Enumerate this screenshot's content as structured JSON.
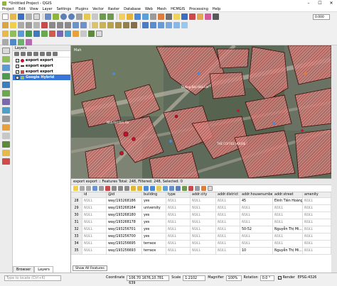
{
  "window": {
    "title": "*Untitled Project - QGIS"
  },
  "menu": [
    "Project",
    "Edit",
    "View",
    "Layer",
    "Settings",
    "Plugins",
    "Vector",
    "Raster",
    "Database",
    "Web",
    "Mesh",
    "HCMGIS",
    "Processing",
    "Help"
  ],
  "toolbar": {
    "zoom_value": "0.000"
  },
  "layers_panel": {
    "title": "Layers",
    "layers": [
      {
        "name": "export export",
        "color": "#c8102e",
        "checked": true
      },
      {
        "name": "export export",
        "color": "#333333",
        "checked": true
      },
      {
        "name": "export export",
        "color": "#d14a4a",
        "checked": true
      },
      {
        "name": "Google Hybrid",
        "checked": true,
        "selected": true
      }
    ],
    "tabs": [
      "Browser",
      "Layers"
    ]
  },
  "map_labels": [
    "Mah",
    "Đường Bác Hòa Lợi",
    "Nhà thờ Đức Bà",
    "THE COFFEE HOUSE"
  ],
  "attribute_table": {
    "title": "export export :: Features Total: 248, Filtered: 248, Selected: 0",
    "columns": [
      "id",
      "@id",
      "building",
      "type",
      "addr:city",
      "addr:district",
      "addr:housenumber",
      "addr:street",
      "amenity"
    ],
    "rows": [
      {
        "n": "28",
        "id": "way/193268186",
        "building": "yes",
        "housenumber": "45",
        "street": "Đinh Tiên Hoàng"
      },
      {
        "n": "29",
        "id": "way/193268184",
        "building": "university",
        "housenumber": "NULL",
        "street": "NULL"
      },
      {
        "n": "30",
        "id": "way/193268180",
        "building": "yes",
        "housenumber": "NULL",
        "street": "NULL"
      },
      {
        "n": "31",
        "id": "way/193268178",
        "building": "yes",
        "housenumber": "NULL",
        "street": "NULL"
      },
      {
        "n": "32",
        "id": "way/193256701",
        "building": "yes",
        "housenumber": "50-52",
        "street": "Nguyễn Thị Mi..."
      },
      {
        "n": "33",
        "id": "way/193256700",
        "building": "yes",
        "housenumber": "NULL",
        "street": "NULL"
      },
      {
        "n": "34",
        "id": "way/193256695",
        "building": "terrace",
        "housenumber": "NULL",
        "street": "NULL"
      },
      {
        "n": "35",
        "id": "way/193256693",
        "building": "terrace",
        "housenumber": "10",
        "street": "Nguyễn Thị Mi..."
      }
    ],
    "null_text": "NULL",
    "show_all": "Show All Features"
  },
  "statusbar": {
    "search_placeholder": "Type to locate (Ctrl+K)",
    "coordinate_label": "Coordinate",
    "coordinate": "106.70 1676,10.781 639",
    "scale_label": "Scale",
    "scale": "1:2102",
    "magnifier_label": "Magnifier",
    "magnifier": "100%",
    "rotation_label": "Rotation",
    "rotation": "0.0 °",
    "render_label": "Render",
    "crs": "EPSG:4326"
  }
}
